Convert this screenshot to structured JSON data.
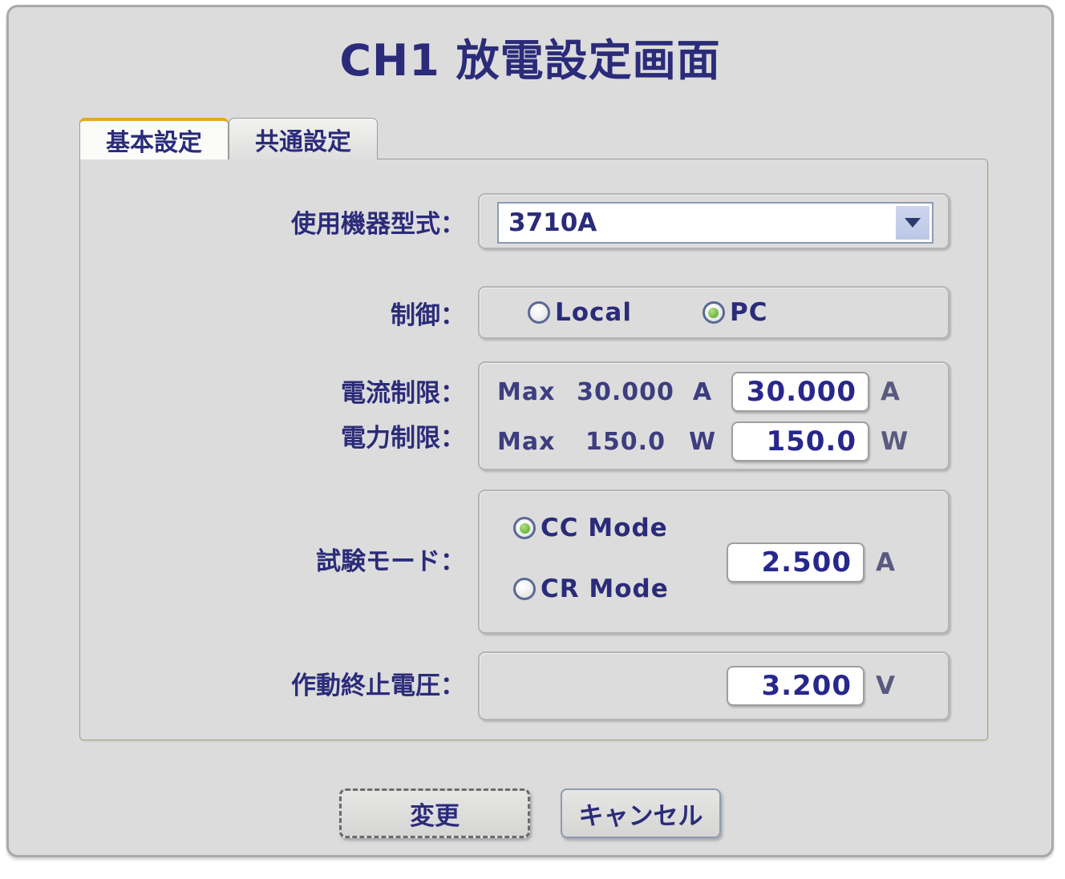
{
  "window": {
    "title": "CH1 放電設定画面"
  },
  "tabs": [
    {
      "label": "基本設定",
      "active": true
    },
    {
      "label": "共通設定",
      "active": false
    }
  ],
  "form": {
    "device_model": {
      "label": "使用機器型式：",
      "value": "3710A",
      "icon": "chevron-down-icon"
    },
    "control": {
      "label": "制御：",
      "options": [
        {
          "label": "Local",
          "selected": false
        },
        {
          "label": "PC",
          "selected": true
        }
      ]
    },
    "current_limit": {
      "label": "電流制限：",
      "max_prefix": "Max",
      "max_value": "30.000",
      "max_unit": "A",
      "value": "30.000",
      "unit": "A"
    },
    "power_limit": {
      "label": "電力制限：",
      "max_prefix": "Max",
      "max_value": "150.0",
      "max_unit": "W",
      "value": "150.0",
      "unit": "W"
    },
    "test_mode": {
      "label": "試験モード：",
      "options": [
        {
          "label": "CC Mode",
          "selected": true
        },
        {
          "label": "CR Mode",
          "selected": false
        }
      ],
      "value": "2.500",
      "unit": "A"
    },
    "cutoff_voltage": {
      "label": "作動終止電圧：",
      "value": "3.200",
      "unit": "V"
    }
  },
  "footer": {
    "change_label": "変更",
    "cancel_label": "キャンセル"
  },
  "colors": {
    "title_text": "#2b2b7a",
    "label_text": "#2b2b7a",
    "value_text": "#27278c",
    "window_bg": "#dcdcdc",
    "active_tab_accent": "#e8a521",
    "radio_selected": "#79c14c"
  }
}
